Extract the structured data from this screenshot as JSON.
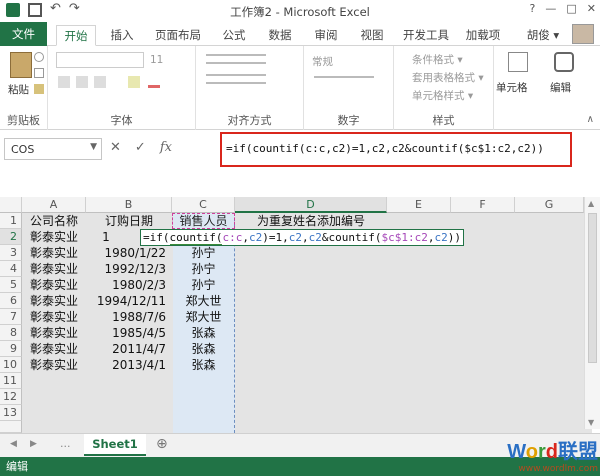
{
  "window": {
    "title": "工作簿2 - Microsoft Excel",
    "help": "?",
    "min": "—",
    "max": "□",
    "close": "✕"
  },
  "tabs": {
    "file": "文件",
    "items": [
      "开始",
      "插入",
      "页面布局",
      "公式",
      "数据",
      "审阅",
      "视图",
      "开发工具",
      "加载项"
    ],
    "user": "胡俊 ▾"
  },
  "ribbon": {
    "groups": [
      "剪贴板",
      "字体",
      "对齐方式",
      "数字",
      "样式",
      "单元格",
      "编辑"
    ],
    "paste": "粘贴",
    "font_size": "11",
    "number_format": "常规",
    "styles": [
      "条件格式 ▾",
      "套用表格格式 ▾",
      "单元格样式 ▾"
    ],
    "cells": "单元格",
    "editing": "编辑"
  },
  "formula_bar": {
    "name_box": "COS",
    "cancel": "✕",
    "enter": "✓",
    "fx": "fx",
    "formula": "=if(countif(c:c,c2)=1,c2,c2&countif($c$1:c2,c2))"
  },
  "columns": [
    "A",
    "B",
    "C",
    "D",
    "E",
    "F",
    "G"
  ],
  "rows": [
    "1",
    "2",
    "3",
    "4",
    "5",
    "6",
    "7",
    "8",
    "9",
    "10",
    "11",
    "12",
    "13"
  ],
  "headers": [
    "公司名称",
    "订购日期",
    "销售人员",
    "为重复姓名添加编号"
  ],
  "edit_cell": {
    "prefix": "=if(",
    "countif": "countif(",
    "ref1": "c:c",
    "comma1": ",",
    "ref2": "c2",
    "mid": ")=1,",
    "ref3": "c2",
    "comma2": ",",
    "ref4": "c2",
    "amp": "&countif(",
    "ref5": "$c$1:c2",
    "comma3": ",",
    "ref6": "c2",
    "end": "))"
  },
  "data_rows": [
    {
      "company": "彰泰实业",
      "date": "1",
      "person": ""
    },
    {
      "company": "彰泰实业",
      "date": "1980/1/22",
      "person": "孙宁"
    },
    {
      "company": "彰泰实业",
      "date": "1992/12/3",
      "person": "孙宁"
    },
    {
      "company": "彰泰实业",
      "date": "1980/2/3",
      "person": "孙宁"
    },
    {
      "company": "彰泰实业",
      "date": "1994/12/11",
      "person": "郑大世"
    },
    {
      "company": "彰泰实业",
      "date": "1988/7/6",
      "person": "郑大世"
    },
    {
      "company": "彰泰实业",
      "date": "1985/4/5",
      "person": "张森"
    },
    {
      "company": "彰泰实业",
      "date": "2011/4/7",
      "person": "张森"
    },
    {
      "company": "彰泰实业",
      "date": "2013/4/1",
      "person": "张森"
    }
  ],
  "sheet": {
    "tab": "Sheet1",
    "add": "⊕",
    "nav_prev": "◀",
    "nav_next": "▶",
    "dots": "..."
  },
  "status": {
    "mode": "编辑"
  },
  "watermark": {
    "brand": "Word联盟",
    "url": "www.wordlm.com"
  },
  "colors": {
    "accent": "#217346",
    "highlight_border": "#d9261c",
    "ref_purple": "#a546b8",
    "ref_blue": "#3a74c4"
  }
}
